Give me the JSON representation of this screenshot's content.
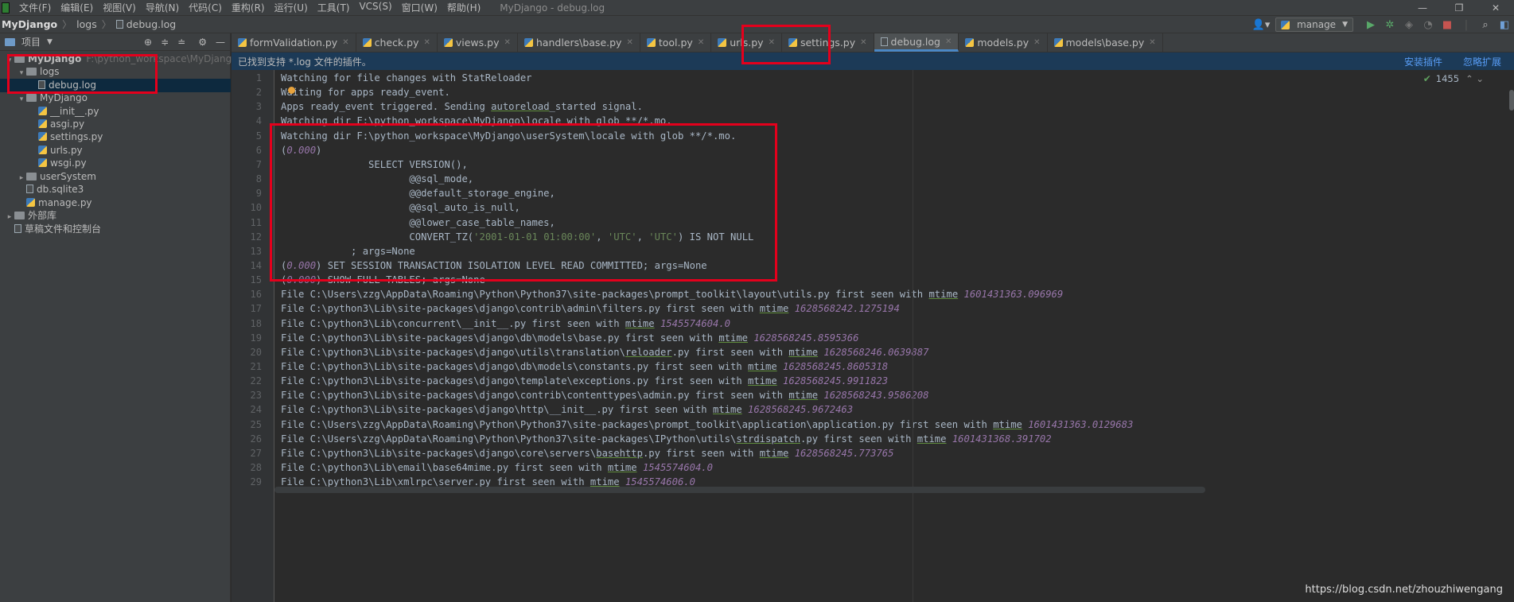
{
  "menubar": {
    "items": [
      "文件(F)",
      "编辑(E)",
      "视图(V)",
      "导航(N)",
      "代码(C)",
      "重构(R)",
      "运行(U)",
      "工具(T)",
      "VCS(S)",
      "窗口(W)",
      "帮助(H)"
    ],
    "window_title": "MyDjango - debug.log",
    "controls": [
      "—",
      "❐",
      "✕"
    ]
  },
  "navbar": {
    "project": "MyDjango",
    "folder": "logs",
    "file": "debug.log",
    "run_config": "manage"
  },
  "project_panel": {
    "title": "项目",
    "tree": [
      {
        "label": "MyDjango",
        "path": "F:\\python_workspace\\MyDjango",
        "arrow": "▾",
        "icon": "folder",
        "depth": 0
      },
      {
        "label": "logs",
        "arrow": "▾",
        "icon": "folder",
        "depth": 1
      },
      {
        "label": "debug.log",
        "icon": "file",
        "depth": 2
      },
      {
        "label": "MyDjango",
        "arrow": "▾",
        "icon": "folder",
        "depth": 1
      },
      {
        "label": "__init__.py",
        "icon": "py",
        "depth": 2
      },
      {
        "label": "asgi.py",
        "icon": "py",
        "depth": 2
      },
      {
        "label": "settings.py",
        "icon": "py",
        "depth": 2
      },
      {
        "label": "urls.py",
        "icon": "py",
        "depth": 2
      },
      {
        "label": "wsgi.py",
        "icon": "py",
        "depth": 2
      },
      {
        "label": "userSystem",
        "arrow": "▸",
        "icon": "folder",
        "depth": 1
      },
      {
        "label": "db.sqlite3",
        "icon": "file",
        "depth": 1
      },
      {
        "label": "manage.py",
        "icon": "py",
        "depth": 1
      },
      {
        "label": "外部库",
        "arrow": "▸",
        "icon": "folder",
        "depth": 0
      },
      {
        "label": "草稿文件和控制台",
        "icon": "file",
        "depth": 0
      }
    ]
  },
  "tabs": [
    {
      "label": "formValidation.py",
      "icon": "py"
    },
    {
      "label": "check.py",
      "icon": "py"
    },
    {
      "label": "views.py",
      "icon": "py"
    },
    {
      "label": "handlers\\base.py",
      "icon": "py"
    },
    {
      "label": "tool.py",
      "icon": "py"
    },
    {
      "label": "urls.py",
      "icon": "py"
    },
    {
      "label": "settings.py",
      "icon": "py"
    },
    {
      "label": "debug.log",
      "icon": "file",
      "active": true
    },
    {
      "label": "models.py",
      "icon": "py"
    },
    {
      "label": "models\\base.py",
      "icon": "py"
    }
  ],
  "notification": {
    "text": "已找到支持 *.log 文件的插件。",
    "install": "安装插件",
    "ignore": "忽略扩展"
  },
  "inspection": {
    "count": "1455"
  },
  "lines": [
    [
      {
        "t": "Watching for file changes with StatReloader"
      }
    ],
    [
      {
        "t": "Waiting for apps ready_event."
      }
    ],
    [
      {
        "t": "Apps ready_event triggered. Sending "
      },
      {
        "t": "autoreload",
        "c": "hl-uline"
      },
      {
        "t": "_started signal."
      }
    ],
    [
      {
        "t": "Watching dir F:\\python_workspace\\MyDjango\\locale with glob **/*.mo."
      }
    ],
    [
      {
        "t": "Watching dir F:\\python_workspace\\MyDjango\\userSystem\\locale with glob **/*.mo."
      }
    ],
    [
      {
        "t": "("
      },
      {
        "t": "0.000",
        "c": "num"
      },
      {
        "t": ")"
      }
    ],
    [
      {
        "t": "               SELECT VERSION(),"
      }
    ],
    [
      {
        "t": "                      @@sql_mode,"
      }
    ],
    [
      {
        "t": "                      @@default_storage_engine,"
      }
    ],
    [
      {
        "t": "                      @@sql_auto_is_null,"
      }
    ],
    [
      {
        "t": "                      @@lower_case_table_names,"
      }
    ],
    [
      {
        "t": "                      CONVERT_TZ("
      },
      {
        "t": "'2001-01-01 01:00:00'",
        "c": "str"
      },
      {
        "t": ", "
      },
      {
        "t": "'UTC'",
        "c": "str"
      },
      {
        "t": ", "
      },
      {
        "t": "'UTC'",
        "c": "str"
      },
      {
        "t": ") IS NOT NULL"
      }
    ],
    [
      {
        "t": "            ; args=None"
      }
    ],
    [
      {
        "t": "("
      },
      {
        "t": "0.000",
        "c": "num"
      },
      {
        "t": ") SET SESSION TRANSACTION ISOLATION LEVEL READ COMMITTED; args=None"
      }
    ],
    [
      {
        "t": "("
      },
      {
        "t": "0.000",
        "c": "num"
      },
      {
        "t": ") SHOW FULL TABLES; args=None"
      }
    ],
    [
      {
        "t": "File C:\\Users\\zzg\\AppData\\Roaming\\Python\\Python37\\site-packages\\prompt_toolkit\\layout\\utils.py first seen with "
      },
      {
        "t": "mtime",
        "c": "hl-uline"
      },
      {
        "t": " "
      },
      {
        "t": "1601431363.096969",
        "c": "num"
      }
    ],
    [
      {
        "t": "File C:\\python3\\Lib\\site-packages\\django\\contrib\\admin\\filters.py first seen with "
      },
      {
        "t": "mtime",
        "c": "hl-uline"
      },
      {
        "t": " "
      },
      {
        "t": "1628568242.1275194",
        "c": "num"
      }
    ],
    [
      {
        "t": "File C:\\python3\\Lib\\concurrent\\__init__.py first seen with "
      },
      {
        "t": "mtime",
        "c": "hl-uline"
      },
      {
        "t": " "
      },
      {
        "t": "1545574604.0",
        "c": "num"
      }
    ],
    [
      {
        "t": "File C:\\python3\\Lib\\site-packages\\django\\db\\models\\base.py first seen with "
      },
      {
        "t": "mtime",
        "c": "hl-uline"
      },
      {
        "t": " "
      },
      {
        "t": "1628568245.8595366",
        "c": "num"
      }
    ],
    [
      {
        "t": "File C:\\python3\\Lib\\site-packages\\django\\utils\\translation\\"
      },
      {
        "t": "reloader",
        "c": "hl-uline"
      },
      {
        "t": ".py first seen with "
      },
      {
        "t": "mtime",
        "c": "hl-uline"
      },
      {
        "t": " "
      },
      {
        "t": "1628568246.0639887",
        "c": "num"
      }
    ],
    [
      {
        "t": "File C:\\python3\\Lib\\site-packages\\django\\db\\models\\constants.py first seen with "
      },
      {
        "t": "mtime",
        "c": "hl-uline"
      },
      {
        "t": " "
      },
      {
        "t": "1628568245.8605318",
        "c": "num"
      }
    ],
    [
      {
        "t": "File C:\\python3\\Lib\\site-packages\\django\\template\\exceptions.py first seen with "
      },
      {
        "t": "mtime",
        "c": "hl-uline"
      },
      {
        "t": " "
      },
      {
        "t": "1628568245.9911823",
        "c": "num"
      }
    ],
    [
      {
        "t": "File C:\\python3\\Lib\\site-packages\\django\\contrib\\contenttypes\\admin.py first seen with "
      },
      {
        "t": "mtime",
        "c": "hl-uline"
      },
      {
        "t": " "
      },
      {
        "t": "1628568243.9586208",
        "c": "num"
      }
    ],
    [
      {
        "t": "File C:\\python3\\Lib\\site-packages\\django\\http\\__init__.py first seen with "
      },
      {
        "t": "mtime",
        "c": "hl-uline"
      },
      {
        "t": " "
      },
      {
        "t": "1628568245.9672463",
        "c": "num"
      }
    ],
    [
      {
        "t": "File C:\\Users\\zzg\\AppData\\Roaming\\Python\\Python37\\site-packages\\prompt_toolkit\\application\\application.py first seen with "
      },
      {
        "t": "mtime",
        "c": "hl-uline"
      },
      {
        "t": " "
      },
      {
        "t": "1601431363.0129683",
        "c": "num"
      }
    ],
    [
      {
        "t": "File C:\\Users\\zzg\\AppData\\Roaming\\Python\\Python37\\site-packages\\IPython\\utils\\"
      },
      {
        "t": "strdispatch",
        "c": "hl-uline"
      },
      {
        "t": ".py first seen with "
      },
      {
        "t": "mtime",
        "c": "hl-uline"
      },
      {
        "t": " "
      },
      {
        "t": "1601431368.391702",
        "c": "num"
      }
    ],
    [
      {
        "t": "File C:\\python3\\Lib\\site-packages\\django\\core\\servers\\"
      },
      {
        "t": "basehttp",
        "c": "hl-uline"
      },
      {
        "t": ".py first seen with "
      },
      {
        "t": "mtime",
        "c": "hl-uline"
      },
      {
        "t": " "
      },
      {
        "t": "1628568245.773765",
        "c": "num"
      }
    ],
    [
      {
        "t": "File C:\\python3\\Lib\\email\\base64mime.py first seen with "
      },
      {
        "t": "mtime",
        "c": "hl-uline"
      },
      {
        "t": " "
      },
      {
        "t": "1545574604.0",
        "c": "num"
      }
    ],
    [
      {
        "t": "File C:\\python3\\Lib\\xmlrpc\\server.py first seen with "
      },
      {
        "t": "mtime",
        "c": "hl-uline"
      },
      {
        "t": " "
      },
      {
        "t": "1545574606.0",
        "c": "num"
      }
    ]
  ],
  "watermark": "https://blog.csdn.net/zhouzhiwengang",
  "colors": {
    "annotation": "#e4001c",
    "accent": "#4a88c7"
  }
}
